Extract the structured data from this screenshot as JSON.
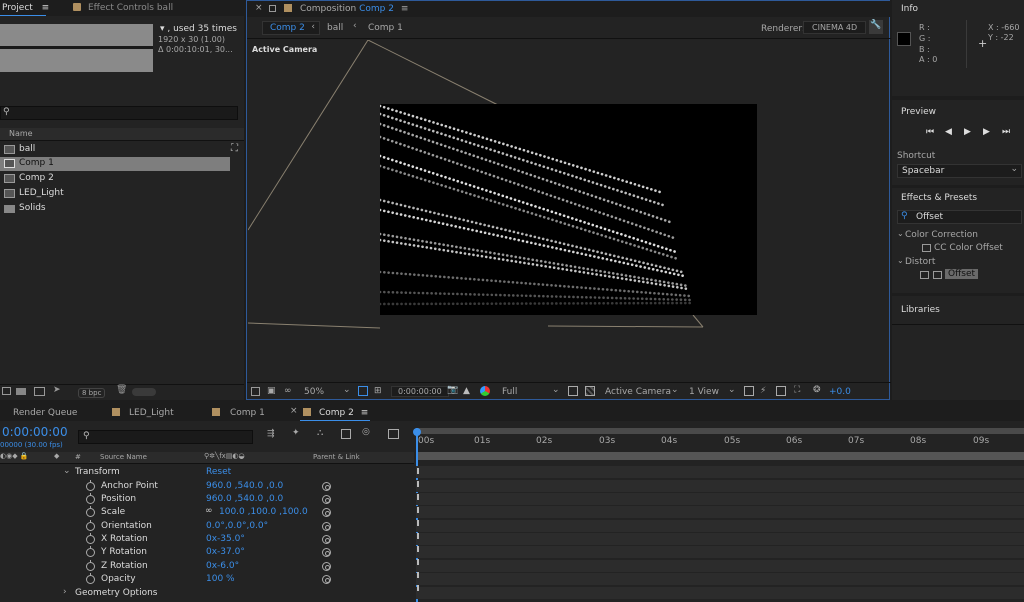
{
  "project": {
    "tab_project": "Project",
    "tab_effect_controls": "Effect Controls ball",
    "info_used": "▾ , used 35 times",
    "info_size": "1920 x 30 (1.00)",
    "info_duration": "Δ 0:00:10:01, 30...",
    "search_icon": "search-icon",
    "col_name": "Name",
    "items": [
      {
        "label": "ball",
        "icon": "comp-icon"
      },
      {
        "label": "Comp 1",
        "icon": "comp-icon"
      },
      {
        "label": "Comp 2",
        "icon": "comp-icon"
      },
      {
        "label": "LED_Light",
        "icon": "comp-icon"
      },
      {
        "label": "Solids",
        "icon": "folder-icon"
      }
    ],
    "bpc": "8 bpc"
  },
  "composition": {
    "tab_prefix": "Composition",
    "tab_comp": "Comp 2",
    "crumbs": [
      "Comp 2",
      "ball",
      "Comp 1"
    ],
    "renderer_label": "Renderer:",
    "renderer_value": "CINEMA 4D",
    "active_camera": "Active Camera",
    "zoom": "50%",
    "timecode": "0:00:00:00",
    "resolution": "Full",
    "view": "Active Camera",
    "views_count": "1 View",
    "exposure": "+0.0"
  },
  "info": {
    "title": "Info",
    "r": "R :",
    "g": "G :",
    "b": "B :",
    "a": "A : 0",
    "x": "X : -660",
    "y": "Y : -22"
  },
  "preview": {
    "title": "Preview",
    "shortcut_label": "Shortcut",
    "shortcut_value": "Spacebar"
  },
  "effects": {
    "title": "Effects & Presets",
    "search_value": "Offset",
    "cat1": "Color Correction",
    "cat1_item": "CC Color Offset",
    "cat2": "Distort",
    "cat2_item": "Offset"
  },
  "libraries": {
    "title": "Libraries"
  },
  "timeline": {
    "tabs": [
      "Render Queue",
      "LED_Light",
      "Comp 1",
      "Comp 2"
    ],
    "timecode": "0:00:00:00",
    "fps": "00000 (30.00 fps)",
    "col_hash": "#",
    "col_source": "Source Name",
    "col_parent": "Parent & Link",
    "transform": "Transform",
    "reset": "Reset",
    "ruler": [
      "00s",
      "01s",
      "02s",
      "03s",
      "04s",
      "05s",
      "06s",
      "07s",
      "08s",
      "09s"
    ],
    "props": [
      {
        "name": "Anchor Point",
        "value": "960.0 ,540.0 ,0.0"
      },
      {
        "name": "Position",
        "value": "960.0 ,540.0 ,0.0"
      },
      {
        "name": "Scale",
        "value": "100.0 ,100.0 ,100.0"
      },
      {
        "name": "Orientation",
        "value": "0.0°,0.0°,0.0°"
      },
      {
        "name": "X Rotation",
        "value": "0x-35.0°"
      },
      {
        "name": "Y Rotation",
        "value": "0x-37.0°"
      },
      {
        "name": "Z Rotation",
        "value": "0x-6.0°"
      },
      {
        "name": "Opacity",
        "value": "100 %"
      }
    ],
    "geometry": "Geometry Options"
  }
}
